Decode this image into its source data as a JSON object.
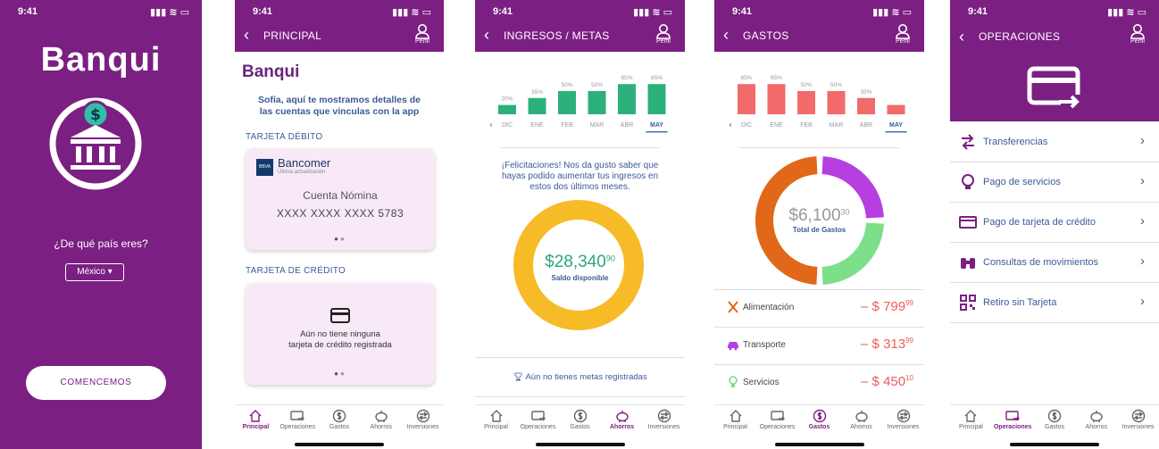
{
  "status_time": "9:41",
  "welcome": {
    "brand": "Banqui",
    "question": "¿De qué país eres?",
    "country": "México",
    "start": "COMENCEMOS"
  },
  "principal": {
    "title": "PRINCIPAL",
    "brand": "Banqui",
    "intro": "Sofía, aquí te mostramos detalles de las cuentas que vinculas con la app",
    "debit_section": "TARJETA DÉBITO",
    "bank_logo": "BBVA",
    "bank_name": "Bancomer",
    "last_update": "Última actualización",
    "account_name": "Cuenta Nómina",
    "account_number": "XXXX XXXX XXXX 5783",
    "credit_section": "TARJETA DE CRÉDITO",
    "credit_empty_1": "Aún no tiene ninguna",
    "credit_empty_2": "tarjeta de crédito registrada"
  },
  "ingresos": {
    "title": "INGRESOS / METAS",
    "congrats": "¡Felicitaciones! Nos da gusto saber que hayas podido aumentar tus ingresos en estos dos últimos meses.",
    "amount": "$28,340",
    "cents": "90",
    "amount_label": "Saldo disponible",
    "goals": "Aún no tienes metas registradas"
  },
  "gastos": {
    "title": "GASTOS",
    "amount": "$6,100",
    "cents": "30",
    "amount_label": "Total de Gastos",
    "rows": [
      {
        "name": "Alimentación",
        "amount": "– $ 799",
        "cents": "99"
      },
      {
        "name": "Transporte",
        "amount": "– $ 313",
        "cents": "99"
      },
      {
        "name": "Servicios",
        "amount": "– $ 450",
        "cents": "10"
      }
    ]
  },
  "operaciones": {
    "title": "OPERACIONES",
    "items": [
      {
        "label": "Transferencias",
        "icon": "transfer-icon"
      },
      {
        "label": "Pago de servicios",
        "icon": "lightbulb-icon"
      },
      {
        "label": "Pago de tarjeta de crédito",
        "icon": "credit-card-icon"
      },
      {
        "label": "Consultas de movimientos",
        "icon": "binoculars-icon"
      },
      {
        "label": "Retiro sin Tarjeta",
        "icon": "qr-code-icon"
      }
    ]
  },
  "profile_label": "Perfil",
  "tabs": [
    "Principal",
    "Operaciones",
    "Gastos",
    "Ahorros",
    "Inversiones"
  ],
  "chart_data": [
    {
      "type": "bar",
      "categories": [
        "DIC",
        "ENE",
        "FEB",
        "MAR",
        "ABR",
        "MAY"
      ],
      "values": [
        20,
        35,
        50,
        50,
        65,
        65
      ],
      "value_labels": [
        "20%",
        "35%",
        "50%",
        "50%",
        "65%",
        "65%"
      ],
      "ylim": [
        0,
        100
      ],
      "selected": "MAY",
      "color": "#2cb07c"
    },
    {
      "type": "bar",
      "categories": [
        "DIC",
        "ENE",
        "FEB",
        "MAR",
        "ABR",
        "MAY"
      ],
      "values": [
        65,
        65,
        50,
        50,
        35,
        20
      ],
      "value_labels": [
        "65%",
        "65%",
        "50%",
        "50%",
        "35%",
        ""
      ],
      "ylim": [
        0,
        100
      ],
      "selected": "MAY",
      "color": "#f26a6a"
    },
    {
      "type": "pie",
      "values": [
        100
      ],
      "colors": [
        "#f6bb27"
      ]
    },
    {
      "type": "pie",
      "values": [
        50,
        25,
        25
      ],
      "colors": [
        "#e06818",
        "#b63fe2",
        "#7ddf8a"
      ]
    }
  ],
  "colors": {
    "brand": "#7b1f82",
    "accent_blue": "#3c5a99",
    "negative": "#ef5a5a"
  }
}
